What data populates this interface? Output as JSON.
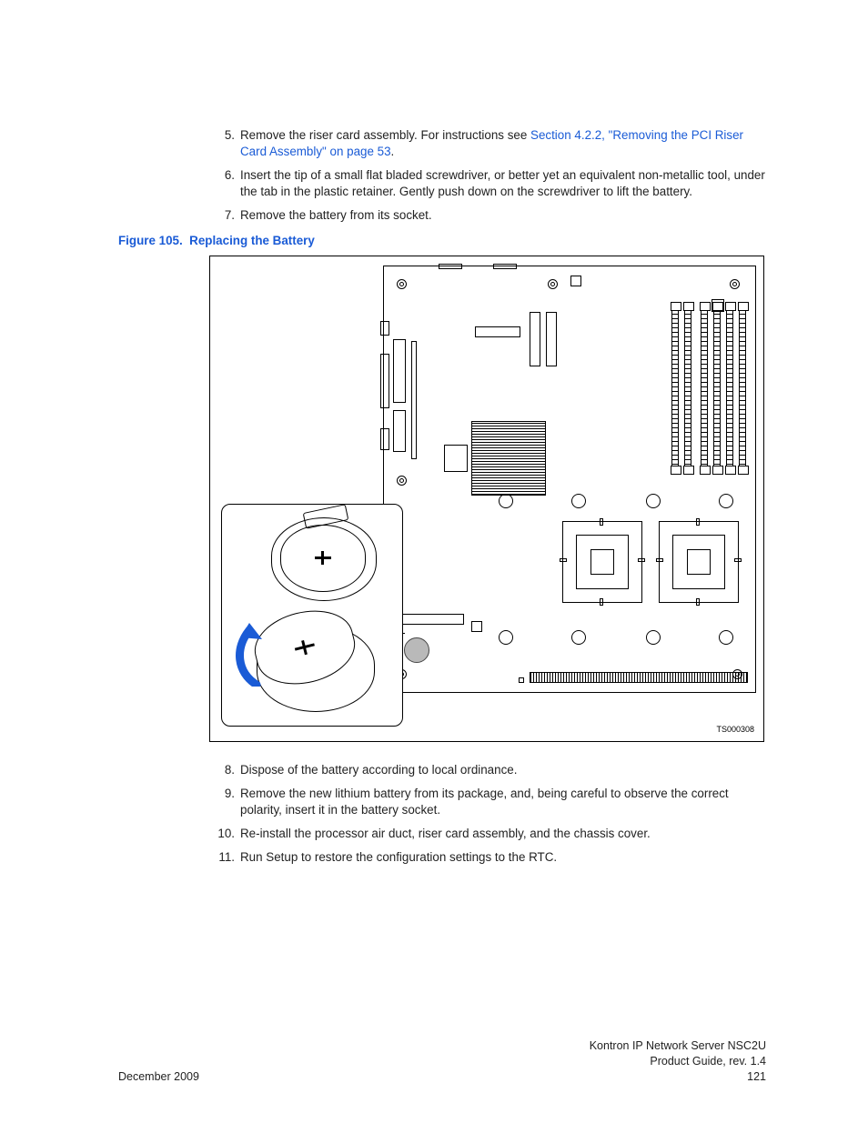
{
  "steps_a": [
    {
      "n": "5.",
      "text_before": "Remove the riser card assembly. For instructions see ",
      "link": "Section 4.2.2, \"Removing the PCI Riser Card Assembly\" on page 53",
      "text_after": "."
    },
    {
      "n": "6.",
      "text": "Insert the tip of a small flat bladed screwdriver, or better yet an equivalent non-metallic tool, under the tab in the plastic retainer. Gently push down on the screwdriver to lift the battery."
    },
    {
      "n": "7.",
      "text": "Remove the battery from its socket."
    }
  ],
  "figure": {
    "label": "Figure 105.",
    "title": "Replacing the Battery",
    "id": "TS000308"
  },
  "steps_b": [
    {
      "n": "8.",
      "text": "Dispose of the battery according to local ordinance."
    },
    {
      "n": "9.",
      "text": "Remove the new lithium battery from its package, and, being careful to observe the correct polarity, insert it in the battery socket."
    },
    {
      "n": "10.",
      "text": "Re-install the processor air duct, riser card assembly, and the chassis cover."
    },
    {
      "n": "11.",
      "text": "Run Setup to restore the configuration settings to the RTC."
    }
  ],
  "footer": {
    "left": "December 2009",
    "r1": "Kontron IP Network Server NSC2U",
    "r2": "Product Guide, rev. 1.4",
    "r3": "121"
  }
}
